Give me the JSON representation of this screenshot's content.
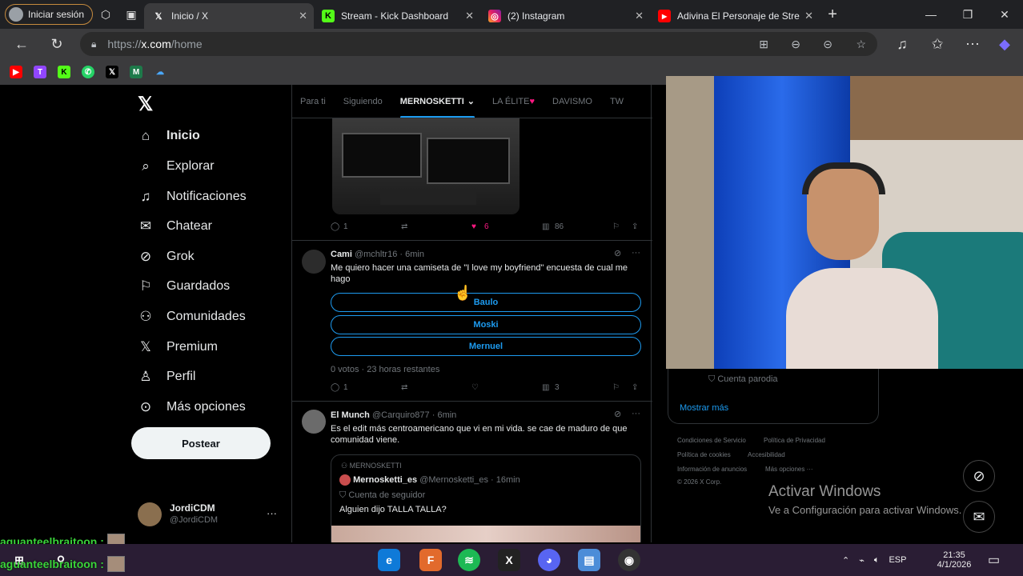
{
  "browser": {
    "profile_label": "Iniciar sesión",
    "tabs": [
      {
        "label": "Inicio / X",
        "icon": "x-logo-icon",
        "active": true
      },
      {
        "label": "Stream - Kick Dashboard",
        "icon": "kick-icon",
        "active": false
      },
      {
        "label": "(2) Instagram",
        "icon": "instagram-icon",
        "active": false
      },
      {
        "label": "Adivina El Personaje de Stre",
        "icon": "youtube-icon",
        "active": false
      }
    ],
    "url_prefix": "https://",
    "url_host": "x.com",
    "url_path": "/home"
  },
  "nav": {
    "items": [
      {
        "label": "Inicio",
        "icon": "home-icon"
      },
      {
        "label": "Explorar",
        "icon": "search-icon"
      },
      {
        "label": "Notificaciones",
        "icon": "bell-icon"
      },
      {
        "label": "Chatear",
        "icon": "mail-icon"
      },
      {
        "label": "Grok",
        "icon": "grok-icon"
      },
      {
        "label": "Guardados",
        "icon": "bookmark-icon"
      },
      {
        "label": "Comunidades",
        "icon": "people-icon"
      },
      {
        "label": "Premium",
        "icon": "x-icon"
      },
      {
        "label": "Perfil",
        "icon": "person-icon"
      },
      {
        "label": "Más opciones",
        "icon": "more-circle-icon"
      }
    ],
    "post_button": "Postear",
    "account": {
      "name": "JordiCDM",
      "handle": "@JordiCDM"
    }
  },
  "feed": {
    "tabs": [
      "Para ti",
      "Siguiendo",
      "MERNOSKETTI",
      "LA ÉLITE",
      "DAVISMO",
      "TW"
    ],
    "post1": {
      "replies": "1",
      "likes": "6",
      "views": "86"
    },
    "post2": {
      "name": "Cami",
      "handle": "@mchltr16",
      "time": "· 6min",
      "text": "Me quiero hacer una camiseta de \"I love my boyfriend\" encuesta de cual me hago",
      "poll_options": [
        "Baulo",
        "Moski",
        "Mernuel"
      ],
      "poll_meta": "0 votos · 23 horas restantes",
      "replies": "1",
      "views": "3"
    },
    "post3": {
      "name": "El Munch",
      "handle": "@Carquiro877",
      "time": "· 6min",
      "text": "Es el edit más centroamericano que vi en mi vida. se cae de maduro de que comunidad viene.",
      "quote": {
        "context": "MERNOSKETTI",
        "name": "Mernosketti_es",
        "handle": "@Mernosketti_es",
        "time": "· 16min",
        "badge": "Cuenta de seguidor",
        "text": "Alguien dijo TALLA TALLA?"
      }
    }
  },
  "right": {
    "card_badge": "Cuenta parodia",
    "show_more": "Mostrar más",
    "footer": [
      "Condiciones de Servicio",
      "Política de Privacidad",
      "Política de cookies",
      "Accesibilidad",
      "Información de anuncios",
      "Más opciones ···",
      "© 2026 X Corp."
    ]
  },
  "windows": {
    "activate_title": "Activar Windows",
    "activate_sub": "Ve a Configuración para activar Windows."
  },
  "chat": [
    {
      "user": "aguanteelbraitoon :"
    },
    {
      "user": "aguanteelbraitoon :"
    }
  ],
  "taskbar": {
    "lang": "ESP",
    "time": "21:35",
    "date": "4/1/2026"
  },
  "colors": {
    "accent": "#1d9bf0",
    "like": "#f91880",
    "chat": "#3ad43a"
  }
}
